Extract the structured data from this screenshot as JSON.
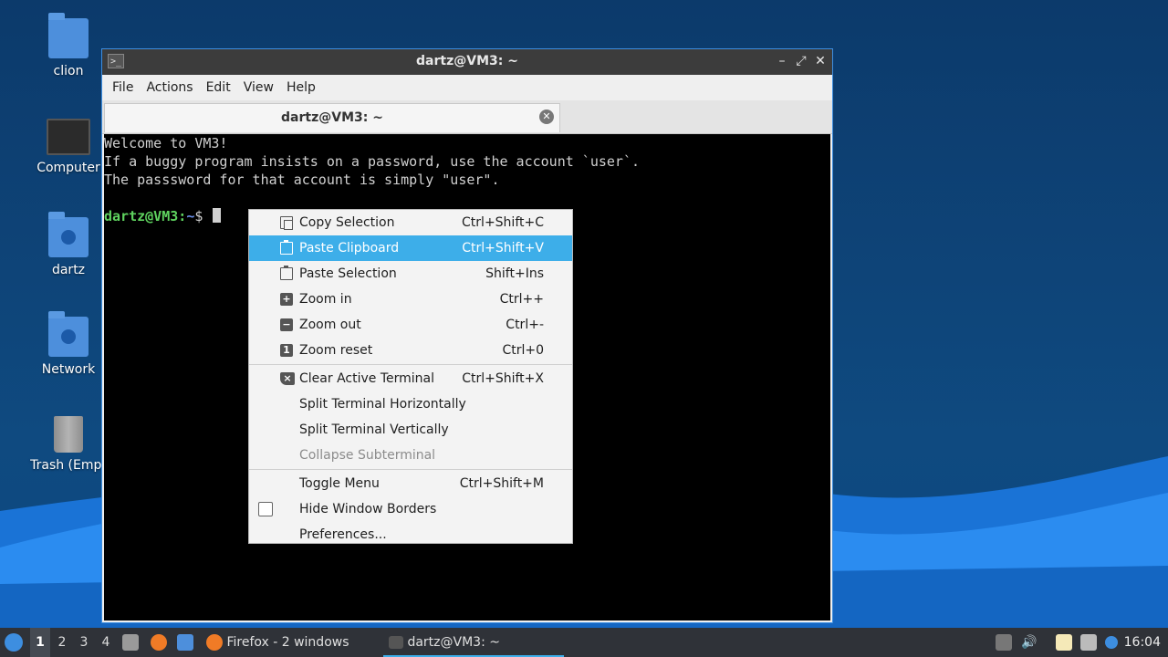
{
  "desktop": {
    "icons": [
      {
        "label": "clion",
        "icon": "folder-icon"
      },
      {
        "label": "Computer",
        "icon": "computer-icon"
      },
      {
        "label": "dartz",
        "icon": "home-folder-icon"
      },
      {
        "label": "Network",
        "icon": "network-folder-icon"
      },
      {
        "label": "Trash (Empt",
        "icon": "trash-icon"
      }
    ]
  },
  "window": {
    "title": "dartz@VM3: ~",
    "menu": [
      "File",
      "Actions",
      "Edit",
      "View",
      "Help"
    ],
    "tab_title": "dartz@VM3: ~",
    "terminal": {
      "lines": [
        "Welcome to VM3!",
        "If a buggy program insists on a password, use the account `user`.",
        "The passsword for that account is simply \"user\"."
      ],
      "prompt_user": "dartz@VM3",
      "prompt_sep": ":",
      "prompt_path": "~",
      "prompt_symbol": "$"
    }
  },
  "context_menu": {
    "items": [
      {
        "label": "Copy Selection",
        "shortcut": "Ctrl+Shift+C",
        "icon": "copy-icon"
      },
      {
        "label": "Paste Clipboard",
        "shortcut": "Ctrl+Shift+V",
        "icon": "paste-icon",
        "highlighted": true
      },
      {
        "label": "Paste Selection",
        "shortcut": "Shift+Ins",
        "icon": "paste-icon"
      },
      {
        "label": "Zoom in",
        "shortcut": "Ctrl++",
        "icon": "zoom-in-icon"
      },
      {
        "label": "Zoom out",
        "shortcut": "Ctrl+-",
        "icon": "zoom-out-icon"
      },
      {
        "label": "Zoom reset",
        "shortcut": "Ctrl+0",
        "icon": "zoom-reset-icon"
      },
      {
        "label": "Clear Active Terminal",
        "shortcut": "Ctrl+Shift+X",
        "icon": "clear-icon"
      },
      {
        "label": "Split Terminal Horizontally",
        "shortcut": ""
      },
      {
        "label": "Split Terminal Vertically",
        "shortcut": ""
      },
      {
        "label": "Collapse Subterminal",
        "shortcut": "",
        "disabled": true
      },
      {
        "label": "Toggle Menu",
        "shortcut": "Ctrl+Shift+M"
      },
      {
        "label": "Hide Window Borders",
        "shortcut": "",
        "checkbox": true,
        "checked": false
      },
      {
        "label": "Preferences...",
        "shortcut": ""
      }
    ]
  },
  "taskbar": {
    "workspaces": [
      "1",
      "2",
      "3",
      "4"
    ],
    "active_workspace": "1",
    "tasks": [
      {
        "label": "Firefox - 2 windows",
        "icon": "firefox-icon"
      },
      {
        "label": "dartz@VM3: ~",
        "icon": "terminal-icon",
        "active": true
      }
    ],
    "clock": "16:04"
  },
  "colors": {
    "highlight": "#3daee9",
    "window_border": "#3d8ee0",
    "prompt_user": "#5fd35f",
    "prompt_path": "#6a8fe8"
  }
}
